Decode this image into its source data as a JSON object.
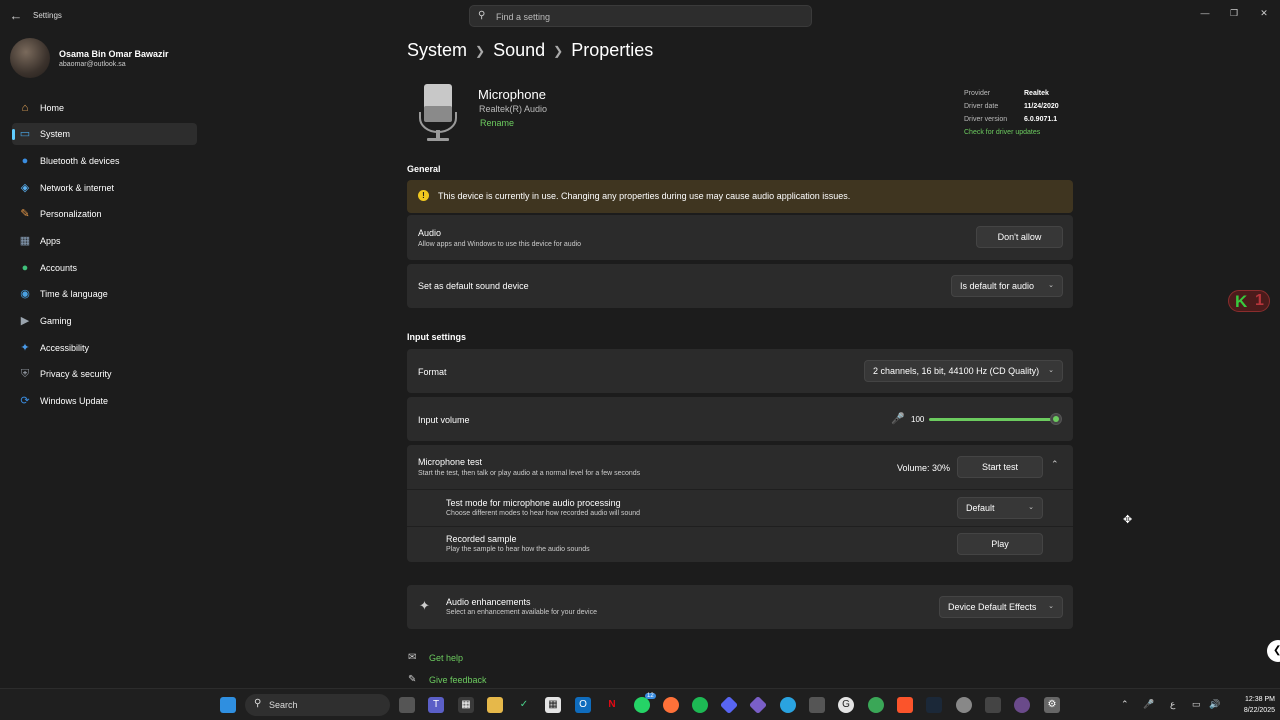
{
  "window": {
    "app_title": "Settings",
    "search_placeholder": "Find a setting",
    "back_icon": "arrow-left-icon",
    "controls": [
      "minimize-icon",
      "maximize-icon",
      "close-icon"
    ]
  },
  "profile": {
    "name": "Osama Bin Omar Bawazir",
    "email": "abaomar@outlook.sa"
  },
  "sidebar": {
    "items": [
      {
        "label": "Home",
        "icon": "home-icon",
        "color": "#e8a85a"
      },
      {
        "label": "System",
        "icon": "monitor-icon",
        "color": "#4aa8e8",
        "selected": true
      },
      {
        "label": "Bluetooth & devices",
        "icon": "bluetooth-icon",
        "color": "#3a8de0"
      },
      {
        "label": "Network & internet",
        "icon": "wifi-icon",
        "color": "#5ab0f0"
      },
      {
        "label": "Personalization",
        "icon": "brush-icon",
        "color": "#e89a4a"
      },
      {
        "label": "Apps",
        "icon": "apps-icon",
        "color": "#8aa0b8"
      },
      {
        "label": "Accounts",
        "icon": "person-icon",
        "color": "#3fc07a"
      },
      {
        "label": "Time & language",
        "icon": "globe-icon",
        "color": "#4aa0e0"
      },
      {
        "label": "Gaming",
        "icon": "gamepad-icon",
        "color": "#9aa4ae"
      },
      {
        "label": "Accessibility",
        "icon": "accessibility-icon",
        "color": "#4a9ae8"
      },
      {
        "label": "Privacy & security",
        "icon": "shield-icon",
        "color": "#8a9098"
      },
      {
        "label": "Windows Update",
        "icon": "update-icon",
        "color": "#3a8de0"
      }
    ]
  },
  "breadcrumb": {
    "items": [
      "System",
      "Sound",
      "Properties"
    ]
  },
  "device": {
    "name": "Microphone",
    "subtitle": "Realtek(R) Audio",
    "rename": "Rename",
    "driver": {
      "provider_label": "Provider",
      "provider": "Realtek",
      "date_label": "Driver date",
      "date": "11/24/2020",
      "version_label": "Driver version",
      "version": "6.0.9071.1",
      "update_link": "Check for driver updates"
    }
  },
  "general": {
    "heading": "General",
    "warning": "This device is currently in use. Changing any properties during use may cause audio application issues.",
    "audio": {
      "title": "Audio",
      "subtitle": "Allow apps and Windows to use this device for audio",
      "button": "Don't allow"
    },
    "default_device": {
      "title": "Set as default sound device",
      "value": "Is default for audio"
    }
  },
  "input_settings": {
    "heading": "Input settings",
    "format": {
      "title": "Format",
      "value": "2 channels, 16 bit, 44100 Hz (CD Quality)"
    },
    "input_volume": {
      "title": "Input volume",
      "value": "100",
      "level": 1.0
    },
    "mic_test": {
      "title": "Microphone test",
      "subtitle": "Start the test, then talk or play audio at a normal level for a few seconds",
      "volume_label": "Volume: 30%",
      "button": "Start test",
      "test_mode": {
        "title": "Test mode for microphone audio processing",
        "subtitle": "Choose different modes to hear how recorded audio will sound",
        "value": "Default"
      },
      "recorded_sample": {
        "title": "Recorded sample",
        "subtitle": "Play the sample to hear how the audio sounds",
        "button": "Play"
      }
    },
    "enhancements": {
      "title": "Audio enhancements",
      "subtitle": "Select an enhancement available for your device",
      "value": "Device Default Effects"
    }
  },
  "help": {
    "get_help": "Get help",
    "give_feedback": "Give feedback"
  },
  "overlay": {
    "letter": "K",
    "number": "1"
  },
  "taskbar": {
    "search_label": "Search",
    "badge_count": "12",
    "time": "12:38 PM",
    "date": "8/22/2025",
    "ime": "ع"
  }
}
